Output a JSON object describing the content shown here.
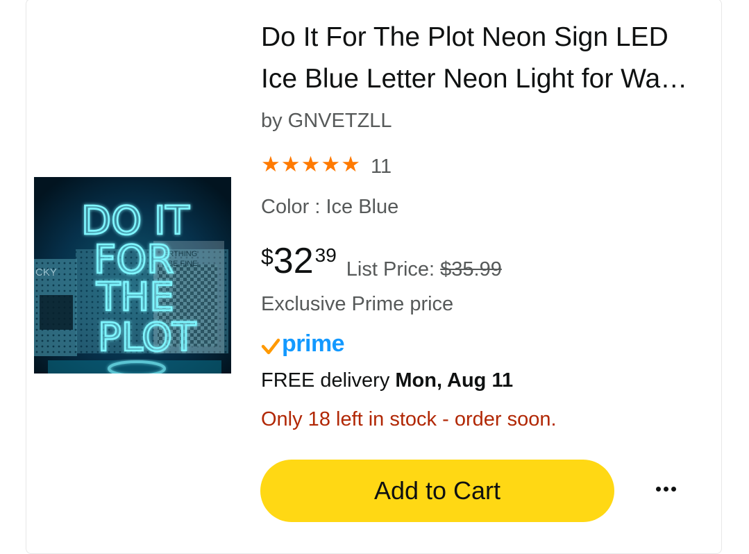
{
  "product": {
    "title": "Do It For The Plot Neon Sign LED Ice Blue Letter Neon Light for Wall Decor",
    "brand": "by GNVETZLL",
    "rating_stars": 5,
    "rating_count": "11",
    "color": "Color : Ice Blue",
    "price": {
      "symbol": "$",
      "whole": "32",
      "fraction": "39",
      "list_label": "List Price: ",
      "list_value": "$35.99"
    },
    "exclusive": "Exclusive Prime price",
    "prime_label": "prime",
    "delivery": {
      "prefix": "FREE delivery ",
      "date": "Mon, Aug 11"
    },
    "stock": "Only 18 left in stock - order soon.",
    "image": {
      "sign_lines": [
        "DO IT",
        "FOR",
        "THE",
        "PLOT"
      ],
      "background_text_1": "CKY",
      "background_text_2": "ERTHING",
      "background_text_3": "L BE FINE"
    }
  },
  "actions": {
    "add_to_cart": "Add to Cart",
    "more_icon": "more-horizontal-icon"
  },
  "colors": {
    "star": "#ff7a00",
    "prime_blue": "#1399ff",
    "prime_check": "#ff9900",
    "cart_button": "#ffd814",
    "stock": "#b12704",
    "neon": "#7ff6ff"
  }
}
